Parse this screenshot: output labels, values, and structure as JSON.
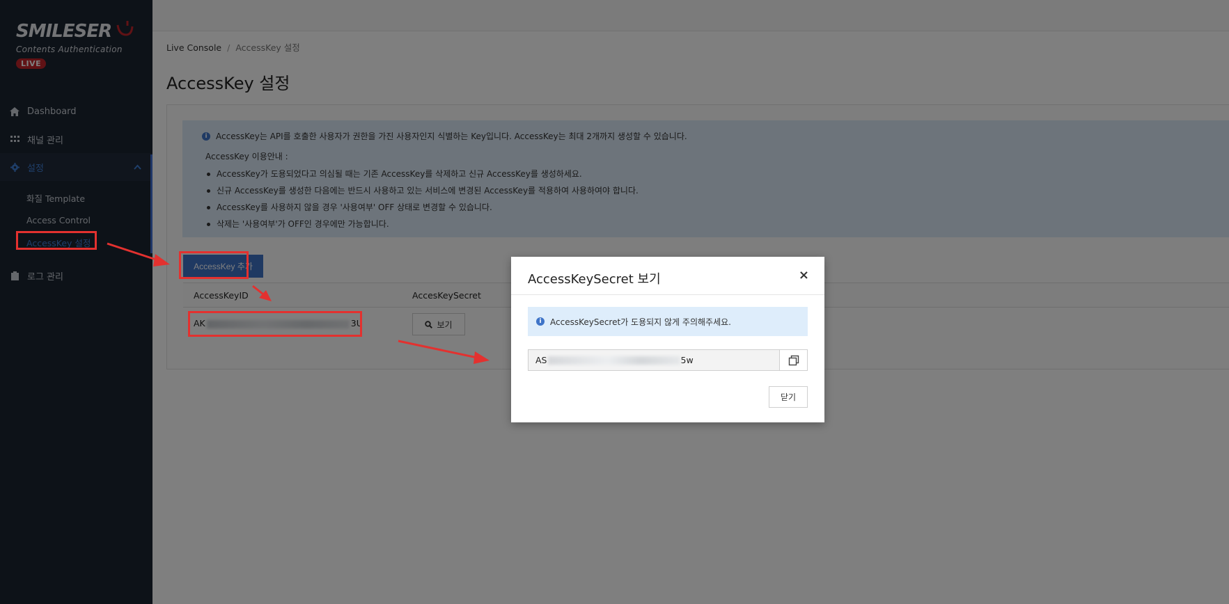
{
  "brand": {
    "logo_text": "SMILESER",
    "subtitle": "Contents Authentication",
    "badge": "LIVE"
  },
  "sidebar": {
    "items": [
      {
        "label": "Dashboard",
        "icon": "home-icon"
      },
      {
        "label": "채널 관리",
        "icon": "grid-icon"
      },
      {
        "label": "설정",
        "icon": "gear-icon"
      },
      {
        "label": "로그 관리",
        "icon": "clipboard-icon"
      }
    ],
    "sub_items": [
      {
        "label": "화질 Template"
      },
      {
        "label": "Access Control"
      },
      {
        "label": "AccessKey 설정"
      }
    ]
  },
  "breadcrumb": {
    "root": "Live Console",
    "separator": "/",
    "current": "AccessKey 설정"
  },
  "page": {
    "title": "AccessKey 설정"
  },
  "info": {
    "main": "AccessKey는 API를 호출한 사용자가 권한을 가진 사용자인지 식별하는 Key입니다. AccessKey는 최대 2개까지 생성할 수 있습니다.",
    "guide_title": "AccessKey 이용안내 :",
    "guide_items": [
      "AccessKey가 도용되었다고 의심될 때는 기존 AccessKey를 삭제하고 신규 AccessKey를 생성하세요.",
      "신규 AccessKey를 생성한 다음에는 반드시 사용하고 있는 서비스에 변경된 AccessKey를 적용하여 사용하여야 합니다.",
      "AccessKey를 사용하지 않을 경우 '사용여부' OFF 상태로 변경할 수 있습니다.",
      "삭제는 '사용여부'가 OFF인 경우에만 가능합니다."
    ]
  },
  "toolbar": {
    "add_label": "AccessKey 추가"
  },
  "table": {
    "headers": [
      "AccessKeyID",
      "AccesKeySecret"
    ],
    "rows": [
      {
        "key_id_prefix": "AK",
        "key_id_suffix": "3U",
        "action_label": "보기"
      }
    ]
  },
  "modal": {
    "title": "AccessKeySecret 보기",
    "close_symbol": "×",
    "alert": "AccessKeySecret가 도용되지 않게 주의해주세요.",
    "secret_prefix": "AS",
    "secret_suffix": "5w",
    "close_button": "닫기"
  },
  "colors": {
    "sidebar_bg": "#1b2431",
    "accent": "#3f72c4",
    "annotation_red": "#e3312f",
    "badge_red": "#c0242b"
  }
}
